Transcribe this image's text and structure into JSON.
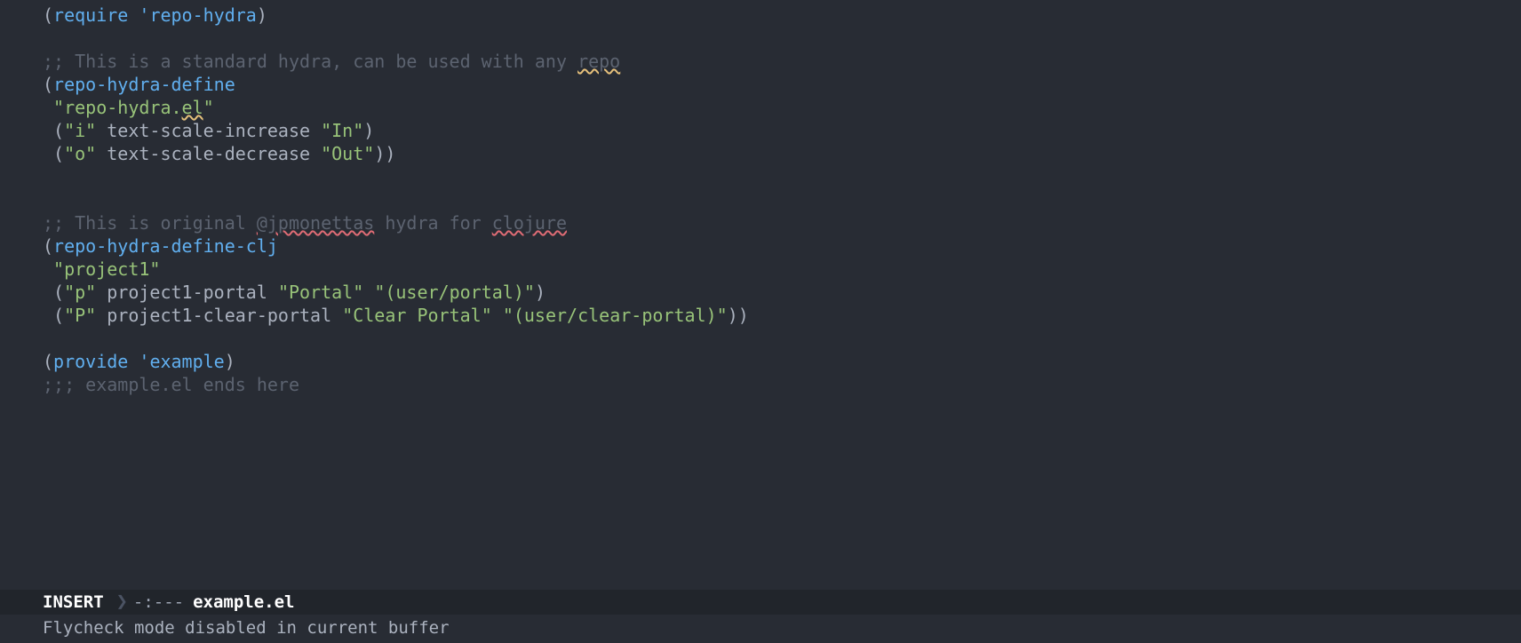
{
  "code": {
    "l1_paren_open": "(",
    "l1_require": "require",
    "l1_space": " ",
    "l1_tick": "'",
    "l1_sym": "repo-hydra",
    "l1_paren_close": ")",
    "l2": "",
    "l3_prefix": ";; This is a standard hydra, can be used with any ",
    "l3_repo": "repo",
    "l4_paren_open": "(",
    "l4_fn": "repo-hydra-define",
    "l5_indent": " ",
    "l5_str_open": "\"repo-hydra.",
    "l5_el": "el",
    "l5_str_close": "\"",
    "l6_indent": " ",
    "l6_p1": "(",
    "l6_key": "\"i\"",
    "l6_sp1": " ",
    "l6_sym": "text-scale-increase",
    "l6_sp2": " ",
    "l6_label": "\"In\"",
    "l6_p2": ")",
    "l7_indent": " ",
    "l7_p1": "(",
    "l7_key": "\"o\"",
    "l7_sp1": " ",
    "l7_sym": "text-scale-decrease",
    "l7_sp2": " ",
    "l7_label": "\"Out\"",
    "l7_p2": "))",
    "l8": "",
    "l9": "",
    "l10_prefix": ";; This is original ",
    "l10_user": "@jpmonettas",
    "l10_mid": " hydra for ",
    "l10_clj": "clojure",
    "l11_paren_open": "(",
    "l11_fn": "repo-hydra-define-clj",
    "l12_indent": " ",
    "l12_str": "\"project1\"",
    "l13_indent": " ",
    "l13_p1": "(",
    "l13_key": "\"p\"",
    "l13_sp1": " ",
    "l13_sym": "project1-portal",
    "l13_sp2": " ",
    "l13_label": "\"Portal\"",
    "l13_sp3": " ",
    "l13_expr": "\"(user/portal)\"",
    "l13_p2": ")",
    "l14_indent": " ",
    "l14_p1": "(",
    "l14_key": "\"P\"",
    "l14_sp1": " ",
    "l14_sym": "project1-clear-portal",
    "l14_sp2": " ",
    "l14_label": "\"Clear Portal\"",
    "l14_sp3": " ",
    "l14_expr": "\"(user/clear-portal)\"",
    "l14_p2": "))",
    "l15": "",
    "l16_paren_open": "(",
    "l16_provide": "provide",
    "l16_sp": " ",
    "l16_tick": "'",
    "l16_sym": "example",
    "l16_paren_close": ")",
    "l17": ";;; example.el ends here"
  },
  "modeline": {
    "state": "INSERT",
    "sep_glyph": "❯",
    "status": "-:---",
    "filename": "example.el"
  },
  "echo": {
    "message": "Flycheck mode disabled in current buffer"
  }
}
